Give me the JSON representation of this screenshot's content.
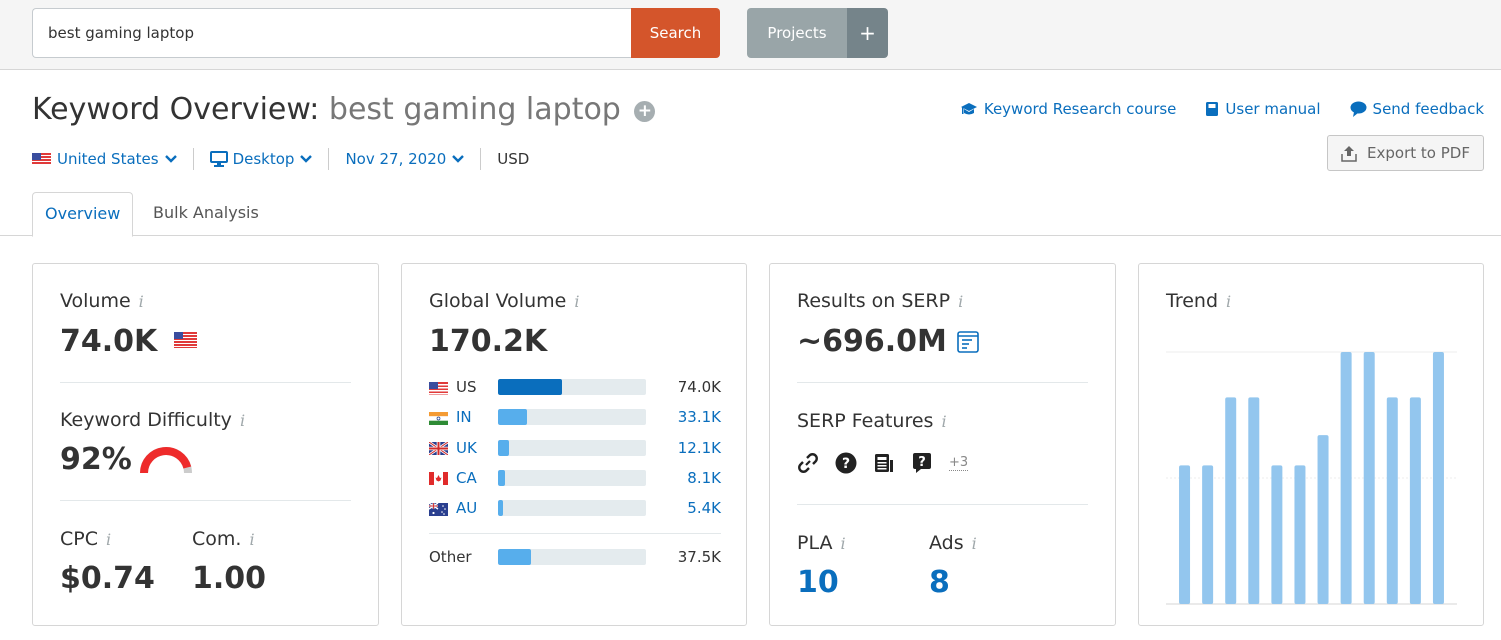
{
  "topbar": {
    "search_value": "best gaming laptop",
    "search_button": "Search",
    "projects_button": "Projects",
    "projects_add": "+"
  },
  "header": {
    "title_prefix": "Keyword Overview:",
    "keyword": "best gaming laptop",
    "filters": {
      "country": "United States",
      "device": "Desktop",
      "date": "Nov 27, 2020",
      "currency": "USD"
    },
    "links": {
      "course": "Keyword Research course",
      "manual": "User manual",
      "feedback": "Send feedback"
    },
    "export_button": "Export to PDF"
  },
  "tabs": [
    {
      "label": "Overview",
      "active": true
    },
    {
      "label": "Bulk Analysis",
      "active": false
    }
  ],
  "volume_card": {
    "volume_label": "Volume",
    "volume_value": "74.0K",
    "kd_label": "Keyword Difficulty",
    "kd_value": "92%",
    "kd_percent": 92,
    "cpc_label": "CPC",
    "cpc_value": "$0.74",
    "com_label": "Com.",
    "com_value": "1.00"
  },
  "global_card": {
    "label": "Global Volume",
    "value": "170.2K",
    "rows": [
      {
        "code": "US",
        "value": "74.0K",
        "share": 0.435,
        "primary": true
      },
      {
        "code": "IN",
        "value": "33.1K",
        "share": 0.195,
        "primary": false
      },
      {
        "code": "UK",
        "value": "12.1K",
        "share": 0.071,
        "primary": false
      },
      {
        "code": "CA",
        "value": "8.1K",
        "share": 0.048,
        "primary": false
      },
      {
        "code": "AU",
        "value": "5.4K",
        "share": 0.032,
        "primary": false
      }
    ],
    "other": {
      "label": "Other",
      "value": "37.5K",
      "share": 0.22
    }
  },
  "serp_card": {
    "results_label": "Results on SERP",
    "results_value": "~696.0M",
    "features_label": "SERP Features",
    "features": [
      "link-icon",
      "question-circle-icon",
      "news-icon",
      "question-bubble-icon"
    ],
    "features_more": "+3",
    "pla_label": "PLA",
    "pla_value": "10",
    "ads_label": "Ads",
    "ads_value": "8"
  },
  "chart_data": {
    "type": "bar",
    "title": "Trend",
    "categories": [
      "1",
      "2",
      "3",
      "4",
      "5",
      "6",
      "7",
      "8",
      "9",
      "10",
      "11",
      "12"
    ],
    "values": [
      0.55,
      0.55,
      0.82,
      0.82,
      0.55,
      0.55,
      0.67,
      1.0,
      1.0,
      0.82,
      0.82,
      1.0
    ],
    "ylim": [
      0,
      1
    ],
    "grid": true,
    "xlabel": "",
    "ylabel": ""
  },
  "colors": {
    "accent": "#0a6ebd",
    "search": "#d4552b",
    "bar_primary": "#0a6ebd",
    "bar_secondary": "#57aeec",
    "trend_bar": "#93c6ee",
    "kd_red": "#ee2b2b"
  }
}
